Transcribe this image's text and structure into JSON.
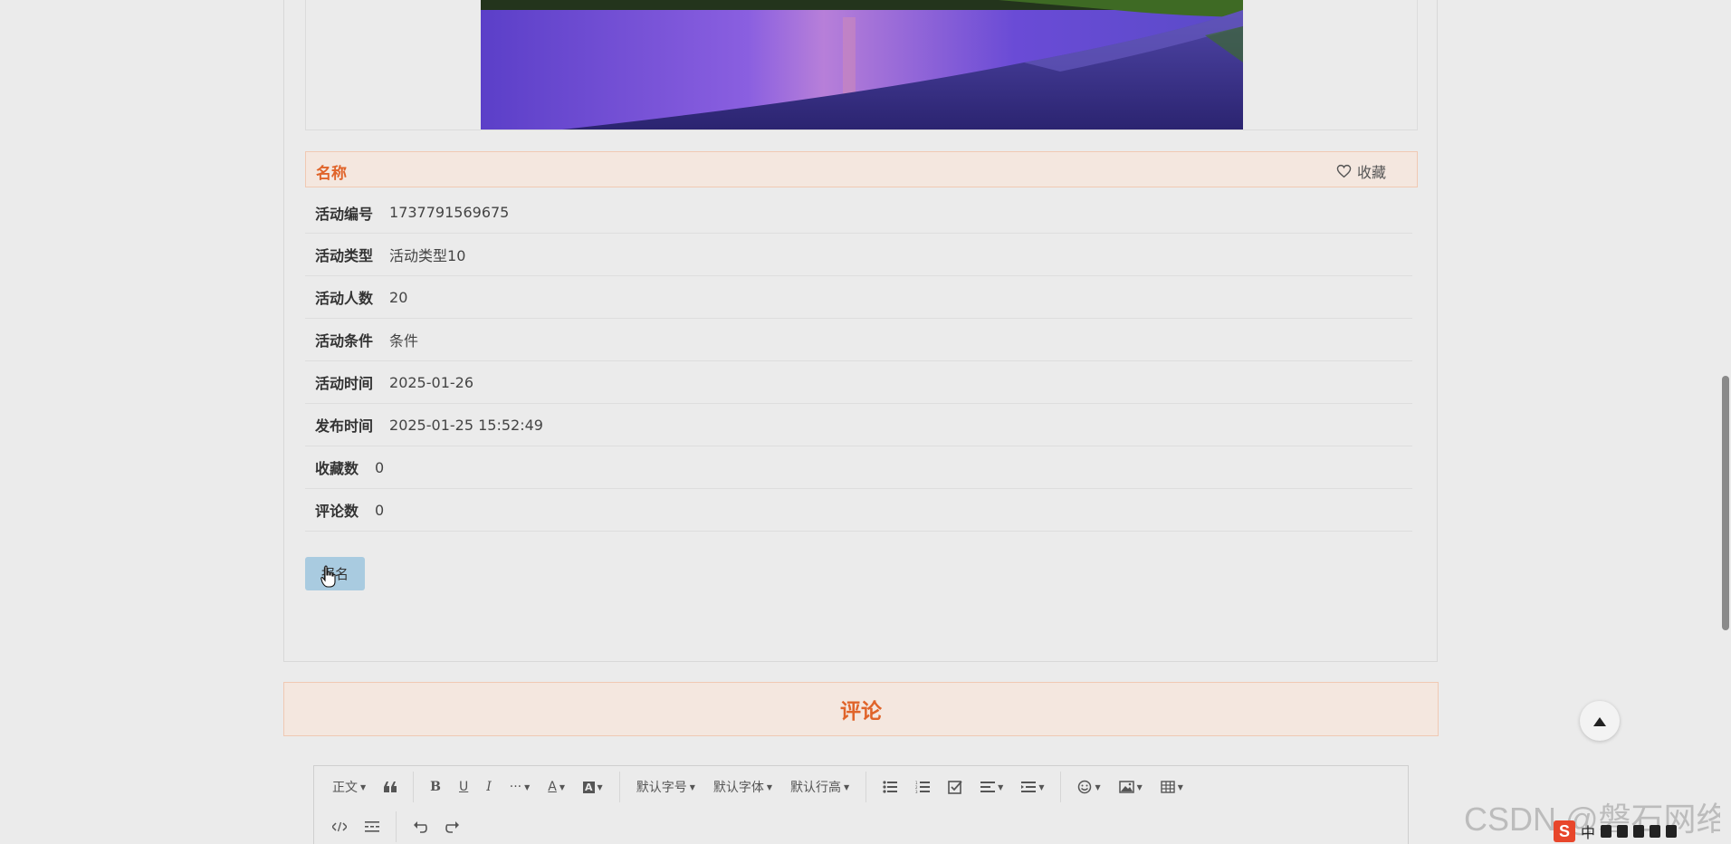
{
  "detail": {
    "title": "名称",
    "favorite_label": "收藏",
    "fields": [
      {
        "label": "活动编号",
        "value": "1737791569675"
      },
      {
        "label": "活动类型",
        "value": "活动类型10"
      },
      {
        "label": "活动人数",
        "value": "20"
      },
      {
        "label": "活动条件",
        "value": "条件"
      },
      {
        "label": "活动时间",
        "value": "2025-01-26"
      },
      {
        "label": "发布时间",
        "value": "2025-01-25 15:52:49"
      },
      {
        "label": "收藏数",
        "value": "0"
      },
      {
        "label": "评论数",
        "value": "0"
      }
    ],
    "signup_label": "报名"
  },
  "comments": {
    "header": "评论"
  },
  "editor": {
    "toolbar": {
      "paragraph": "正文",
      "font_size": "默认字号",
      "font_family": "默认字体",
      "line_height": "默认行高",
      "bold": "B",
      "underline": "U",
      "italic": "I",
      "more": "···",
      "font_color": "A",
      "bg_color": "A"
    }
  },
  "watermark": "CSDN @磐石网络",
  "tray": {
    "ime": "中"
  },
  "colors": {
    "accent": "#e0642a",
    "title_bg": "#f4e7df",
    "button_bg": "#a9cbe0"
  }
}
